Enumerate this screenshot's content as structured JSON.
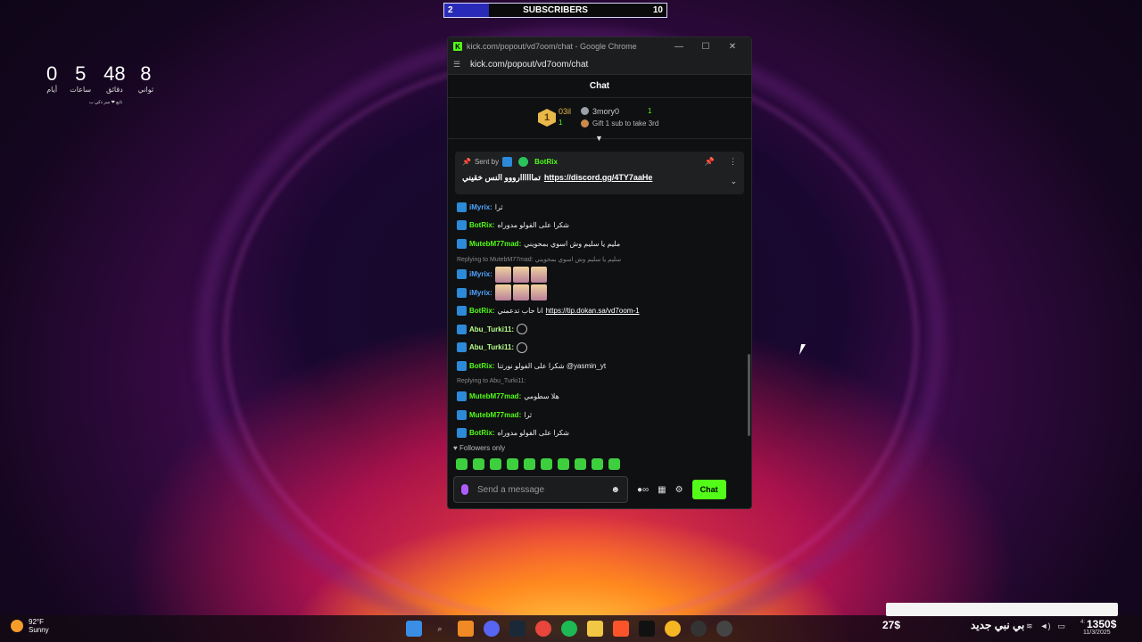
{
  "overlay": {
    "subs_current": "2",
    "subs_label": "SUBSCRIBERS",
    "subs_goal": "10",
    "subs_progress": 0.2
  },
  "countdown": {
    "units": [
      {
        "num": "0",
        "label": "أيام"
      },
      {
        "num": "5",
        "label": "ساعات"
      },
      {
        "num": "48",
        "label": "دقائق"
      },
      {
        "num": "8",
        "label": "ثواني"
      }
    ],
    "note": "تابع ❤ سر ذكي ب"
  },
  "window": {
    "title": "kick.com/popout/vd7oom/chat - Google Chrome",
    "url": "kick.com/popout/vd7oom/chat",
    "chat_title": "Chat"
  },
  "leaderboard": {
    "first_rank": "1",
    "first_name": "03il",
    "first_count": "1",
    "second_name": "3mory0",
    "second_count": "1",
    "gift_text": "Gift 1 sub to take 3rd"
  },
  "pinned": {
    "sent_by": "Sent by",
    "author": "BotRix",
    "text": "تماااااارووو النس خقيني",
    "link": "https://discord.gg/4TY7aaHe"
  },
  "messages": [
    {
      "type": "msg",
      "user": "iMyrix:",
      "color": "blue",
      "text": "ثرا"
    },
    {
      "type": "msg",
      "user": "BotRix:",
      "color": "green",
      "text": "شكرا على الفولو مدوراه"
    },
    {
      "type": "msg",
      "user": "MutebM77mad:",
      "color": "green",
      "text": "مليم يا سليم وش اسوي بمحويني"
    },
    {
      "type": "reply",
      "text": "Replying to MutebM77mad: سليم يا سليم وش اسوي بمحويني"
    },
    {
      "type": "emote",
      "user": "iMyrix:",
      "color": "blue",
      "count": 3
    },
    {
      "type": "emote",
      "user": "iMyrix:",
      "color": "blue",
      "count": 3
    },
    {
      "type": "link",
      "user": "BotRix:",
      "color": "green",
      "text": "انا حاب تدعمني",
      "link": "https://tip.dokan.sa/vd7oom-1"
    },
    {
      "type": "spin",
      "user": "Abu_Turki11:",
      "color": "lime"
    },
    {
      "type": "spin",
      "user": "Abu_Turki11:",
      "color": "lime"
    },
    {
      "type": "msg",
      "user": "BotRix:",
      "color": "green",
      "text": "شكرا على الفولو نورتنا @yasmin_yt"
    },
    {
      "type": "reply",
      "text": "Replying to Abu_Turki11:"
    },
    {
      "type": "msg",
      "user": "MutebM77mad:",
      "color": "green",
      "text": "هلا سطومي"
    },
    {
      "type": "msg",
      "user": "MutebM77mad:",
      "color": "green",
      "text": "ثرا"
    },
    {
      "type": "msg",
      "user": "BotRix:",
      "color": "green",
      "text": "شكرا على الفولو مدوراه"
    }
  ],
  "followers_only": "Followers only",
  "input": {
    "placeholder": "Send a message",
    "send_label": "Chat"
  },
  "taskbar": {
    "temp": "92°F",
    "condition": "Sunny",
    "tray_left": "27$",
    "tray_arabic": "بي نبي جديد",
    "money": "1350$",
    "time": "4:",
    "date": "11/3/2025"
  },
  "colors": {
    "kick_green": "#53fc18",
    "sub_fill": "#2a2ab8"
  }
}
